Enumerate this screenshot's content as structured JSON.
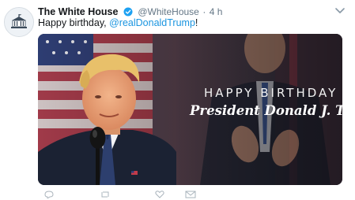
{
  "tweet": {
    "author_name": "The White House",
    "handle": "@WhiteHouse",
    "separator": "·",
    "time": "4 h",
    "text_prefix": "Happy birthday, ",
    "mention": "@realDonaldTrump",
    "text_suffix": "!"
  },
  "media": {
    "headline": "HAPPY BIRTHDAY",
    "subheadline": "President Donald J. Trump"
  },
  "icons": {
    "verified": "verified-badge-icon",
    "menu": "chevron-down-icon",
    "reply": "reply-icon",
    "retweet": "retweet-icon",
    "like": "heart-icon",
    "dm": "envelope-icon"
  },
  "colors": {
    "link": "#1b95e0",
    "text": "#14171a",
    "muted": "#657786"
  }
}
